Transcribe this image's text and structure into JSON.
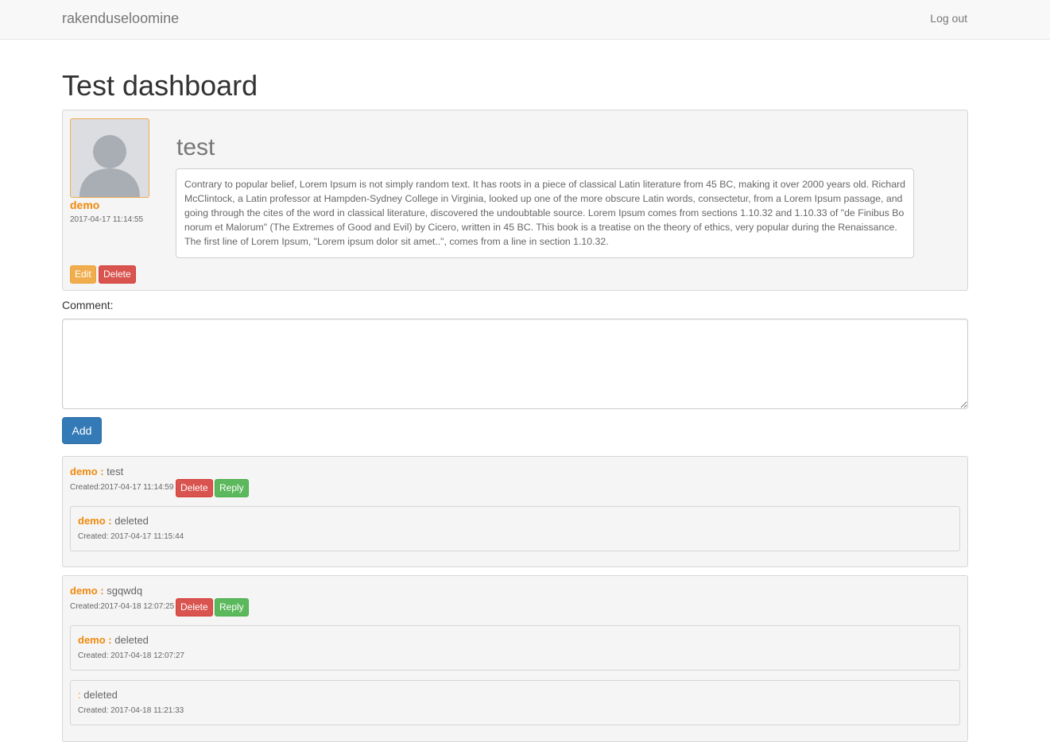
{
  "navbar": {
    "brand": "rakenduseloomine",
    "logout": "Log out"
  },
  "page_title": "Test dashboard",
  "post": {
    "author": "demo",
    "date": "2017-04-17 11:14:55",
    "title": "test",
    "body": "Contrary to popular belief, Lorem Ipsum is not simply random text. It has roots in a piece of classical Latin literature from 45 BC, making it over 2000 years old. Richard McClintock, a Latin professor at Hampden-Sydney College in Virginia, looked up one of the more obscure Latin words, consectetur, from a Lorem Ipsum passage, and going through the cites of the word in classical literature, discovered the undoubtable source. Lorem Ipsum comes from sections 1.10.32 and 1.10.33 of \"de Finibus Bonorum et Malorum\" (The Extremes of Good and Evil) by Cicero, written in 45 BC. This book is a treatise on the theory of ethics, very popular during the Renaissance. The first line of Lorem Ipsum, \"Lorem ipsum dolor sit amet..\", comes from a line in section 1.10.32.",
    "edit_label": "Edit",
    "delete_label": "Delete"
  },
  "comment_form": {
    "label": "Comment:",
    "value": "",
    "add_label": "Add"
  },
  "comments": [
    {
      "author": "demo :",
      "text": "test",
      "created": "Created:2017-04-17 11:14:59",
      "delete_label": "Delete",
      "reply_label": "Reply",
      "replies": [
        {
          "author": "demo :",
          "text": "deleted",
          "created": "Created: 2017-04-17 11:15:44"
        }
      ]
    },
    {
      "author": "demo :",
      "text": "sgqwdq",
      "created": "Created:2017-04-18 12:07:25",
      "delete_label": "Delete",
      "reply_label": "Reply",
      "replies": [
        {
          "author": "demo :",
          "text": "deleted",
          "created": "Created: 2017-04-18 12:07:27"
        },
        {
          "author": ":",
          "text": "deleted",
          "created": "Created: 2017-04-18 11:21:33"
        }
      ]
    }
  ],
  "colors": {
    "accent": "#f0890c",
    "primary": "#337ab7",
    "danger": "#d9534f",
    "success": "#5cb85c",
    "warning": "#f0ad4e"
  }
}
